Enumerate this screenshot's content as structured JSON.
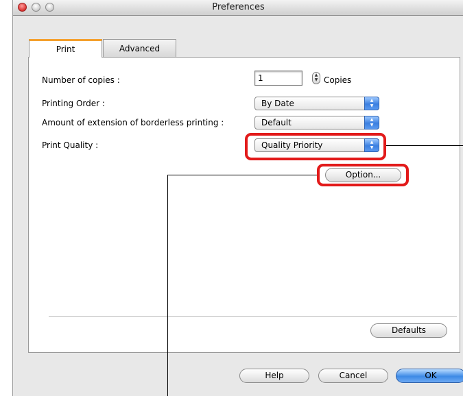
{
  "window": {
    "title": "Preferences"
  },
  "tabs": [
    {
      "label": "Print",
      "active": true
    },
    {
      "label": "Advanced",
      "active": false
    }
  ],
  "form": {
    "copies": {
      "label": "Number of copies :",
      "value": "1",
      "unit": "Copies"
    },
    "printing_order": {
      "label": "Printing Order :",
      "selected": "By Date"
    },
    "extension": {
      "label": "Amount of extension of borderless printing :",
      "selected": "Default"
    },
    "print_quality": {
      "label": "Print Quality :",
      "selected": "Quality Priority"
    }
  },
  "buttons": {
    "option": "Option...",
    "defaults": "Defaults",
    "help": "Help",
    "cancel": "Cancel",
    "ok": "OK"
  },
  "colors": {
    "highlight": "#e21a1a",
    "tab_accent": "#f4a02d",
    "default_button": "#3d8ae6"
  }
}
